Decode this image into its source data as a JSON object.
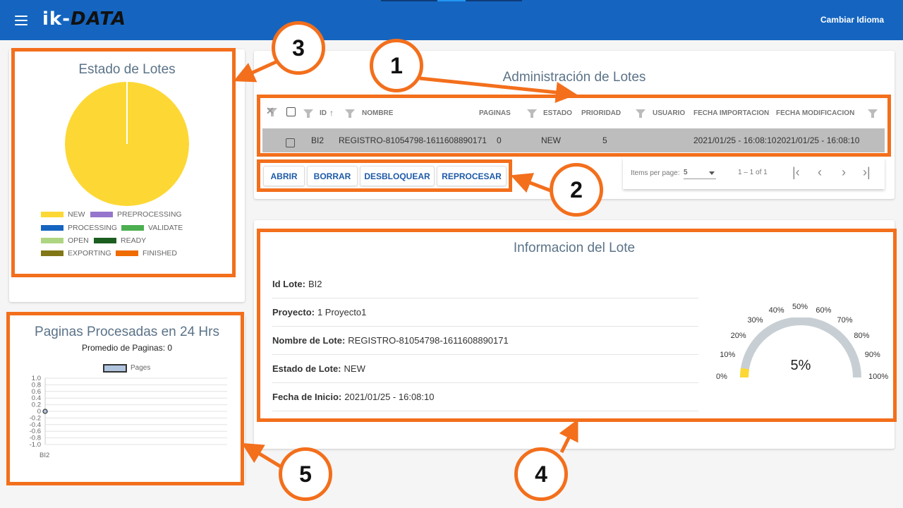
{
  "header": {
    "logo_prefix": "ik-",
    "logo_data": "DATA",
    "menu_icon": "hamburger-menu-icon",
    "language_button": "Cambiar Idioma"
  },
  "lot_status": {
    "title": "Estado de Lotes",
    "legend": [
      {
        "label": "NEW",
        "color": "#fdd835"
      },
      {
        "label": "PREPROCESSING",
        "color": "#9575cd"
      },
      {
        "label": "PROCESSING",
        "color": "#1565c0"
      },
      {
        "label": "VALIDATE",
        "color": "#4caf50"
      },
      {
        "label": "OPEN",
        "color": "#aed581"
      },
      {
        "label": "READY",
        "color": "#1b5e20"
      },
      {
        "label": "EXPORTING",
        "color": "#827717"
      },
      {
        "label": "FINISHED",
        "color": "#ef6c00"
      }
    ]
  },
  "pages_chart": {
    "title": "Paginas Procesadas en 24 Hrs",
    "subtitle": "Promedio de Paginas: 0"
  },
  "chart_data": {
    "type": "line",
    "categories": [
      "BI2"
    ],
    "series": [
      {
        "name": "Pages",
        "values": [
          0
        ]
      }
    ],
    "ylim": [
      -1.0,
      1.0
    ],
    "yticks": [
      "1.0",
      "0.8",
      "0.6",
      "0.4",
      "0.2",
      "0",
      "-0.2",
      "-0.4",
      "-0.6",
      "-0.8",
      "-1.0"
    ],
    "legend_position": "top",
    "grid": true
  },
  "lots_admin": {
    "title": "Administración de Lotes",
    "columns": [
      "ID",
      "NOMBRE",
      "PAGINAS",
      "ESTADO",
      "PRIORIDAD",
      "USUARIO",
      "FECHA IMPORTACION",
      "FECHA MODIFICACION"
    ],
    "sort_icon": "arrow-up-icon",
    "rows": [
      {
        "id": "BI2",
        "nombre": "REGISTRO-81054798-1611608890171",
        "paginas": "0",
        "estado": "NEW",
        "prioridad": "5",
        "usuario": "",
        "fecha_importacion": "2021/01/25 - 16:08:10",
        "fecha_modificacion": "2021/01/25 - 16:08:10"
      }
    ],
    "actions": [
      "ABRIR",
      "BORRAR",
      "DESBLOQUEAR",
      "REPROCESAR"
    ],
    "paginator": {
      "items_per_page_label": "Items per page:",
      "items_per_page_value": "5",
      "range_label": "1 – 1 of 1"
    }
  },
  "lot_info": {
    "title": "Informacion del Lote",
    "fields": [
      {
        "label": "Id Lote:",
        "value": "BI2"
      },
      {
        "label": "Proyecto:",
        "value": "1 Proyecto1"
      },
      {
        "label": "Nombre de Lote:",
        "value": "REGISTRO-81054798-1611608890171"
      },
      {
        "label": "Estado de Lote:",
        "value": "NEW"
      },
      {
        "label": "Fecha de Inicio:",
        "value": "2021/01/25 - 16:08:10"
      }
    ],
    "gauge": {
      "value_label": "5%",
      "value": 0.05,
      "ticks": [
        "0%",
        "10%",
        "20%",
        "30%",
        "40%",
        "50%",
        "60%",
        "70%",
        "80%",
        "90%",
        "100%"
      ]
    }
  },
  "callouts": [
    "1",
    "2",
    "3",
    "4",
    "5"
  ]
}
